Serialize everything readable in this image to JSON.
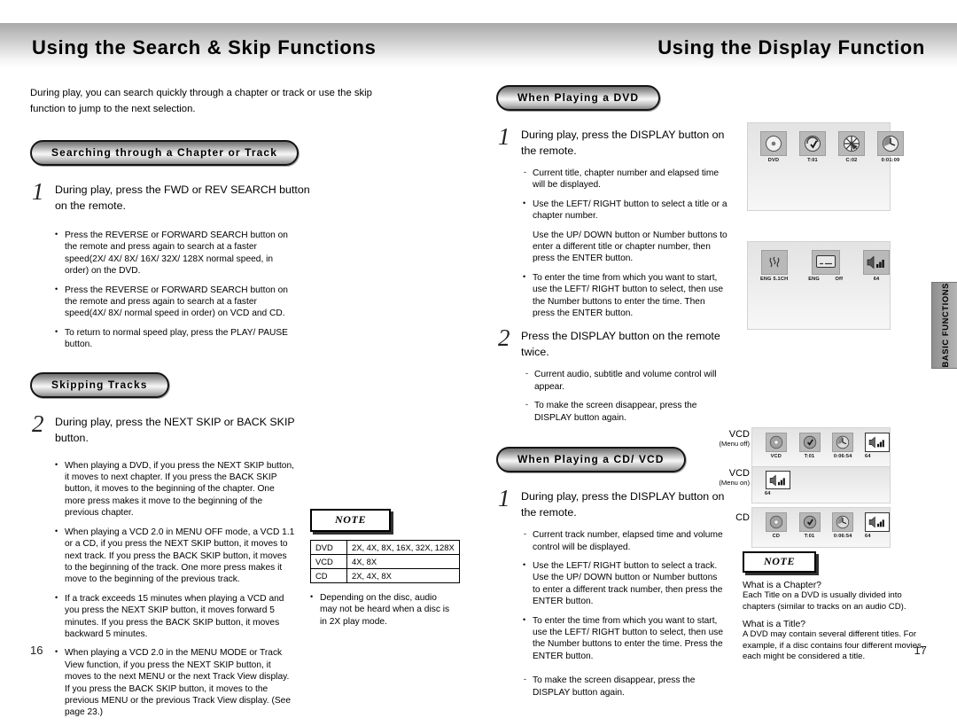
{
  "header": {
    "left_title": "Using the Search & Skip Functions",
    "right_title": "Using the Display Function"
  },
  "side_tab": {
    "line1": "BASIC",
    "line2": "FUNCTIONS"
  },
  "left_page": {
    "page_number": "16",
    "intro": "During play, you can search quickly through a chapter or track or use the skip function to jump to the next selection.",
    "section1": {
      "pill": "Searching through a Chapter or Track",
      "step_number": "1",
      "step_text": "During play, press the FWD or REV SEARCH button on the remote.",
      "bullets": [
        "Press the REVERSE or FORWARD SEARCH button on the remote and press again to search at a faster speed(2X/ 4X/ 8X/ 16X/ 32X/ 128X normal speed, in order) on the DVD.",
        "Press the REVERSE or FORWARD SEARCH button on the remote and press again to search at a faster speed(4X/ 8X/ normal speed in order) on VCD and CD.",
        "To return to normal speed play, press the PLAY/ PAUSE button."
      ]
    },
    "section2": {
      "pill": "Skipping Tracks",
      "step_number": "2",
      "step_text": "During play, press the NEXT SKIP or BACK SKIP button.",
      "bullets": [
        "When playing a DVD, if you press the NEXT SKIP button, it moves to next chapter. If you press the BACK SKIP button, it moves to the beginning of the chapter. One more press makes it move to the beginning of the previous chapter.",
        "When playing a VCD 2.0 in MENU OFF mode, a VCD 1.1 or a CD, if you press the NEXT SKIP button, it moves to next track. If you press the BACK SKIP button, it moves to the beginning of the track. One more press makes it move to the beginning of the previous track.",
        "If a track exceeds 15 minutes when playing a VCD and you press the NEXT SKIP button, it moves forward 5 minutes. If you press the BACK SKIP button, it moves backward 5 minutes.",
        "When playing a VCD 2.0 in the MENU MODE or Track View function, if you press the NEXT SKIP button, it moves to the next MENU or the next Track View display. If you press the BACK SKIP button, it moves to the previous MENU or the previous Track View display. (See page 23.)"
      ]
    },
    "note": {
      "label": "NOTE",
      "table": [
        {
          "disc": "DVD",
          "speeds": "2X, 4X, 8X, 16X, 32X, 128X"
        },
        {
          "disc": "VCD",
          "speeds": "4X, 8X"
        },
        {
          "disc": "CD",
          "speeds": "2X, 4X, 8X"
        }
      ],
      "bullet": "Depending on the disc, audio may not be heard when a disc is in 2X play mode."
    }
  },
  "right_page": {
    "page_number": "17",
    "section_dvd": {
      "pill": "When Playing a DVD",
      "step1": {
        "number": "1",
        "text": "During play, press the DISPLAY button on the remote.",
        "dash1": "Current title, chapter number and elapsed time will be displayed.",
        "bullet1": "Use the LEFT/ RIGHT button to select a title or a chapter number.",
        "plain1": "Use the UP/ DOWN button or Number buttons to enter a different title or chapter number, then press the ENTER button.",
        "bullet2": "To enter the time from which you want to start, use the LEFT/ RIGHT button to select, then use the Number buttons to enter the time. Then press the ENTER button."
      },
      "step2": {
        "number": "2",
        "text": "Press the DISPLAY button on the remote twice.",
        "dash1": "Current audio, subtitle and volume control will appear.",
        "dash2": "To make the screen disappear, press the DISPLAY button again."
      }
    },
    "section_cdvcd": {
      "pill": "When Playing a CD/ VCD",
      "step1": {
        "number": "1",
        "text": "During play, press the DISPLAY button on the remote.",
        "dash1": "Current track number, elapsed time and volume control will be displayed.",
        "bullet1": "Use the LEFT/ RIGHT button to select a track. Use the UP/ DOWN button or Number buttons to enter a different track number, then press the ENTER button.",
        "bullet2": "To enter the time from which you want to start, use the LEFT/ RIGHT button to select, then use the Number buttons to enter the time. Press the ENTER button.",
        "dash2": "To make the screen disappear, press the DISPLAY button again."
      }
    },
    "osd_dvd_1": {
      "items": [
        {
          "icon": "disc-icon",
          "label": "DVD"
        },
        {
          "icon": "title-icon",
          "label": "T:01"
        },
        {
          "icon": "chapter-icon",
          "label": "C:02"
        },
        {
          "icon": "clock-icon",
          "label": "0:01:09"
        }
      ]
    },
    "osd_dvd_2": {
      "items": [
        {
          "icon": "audio-icon",
          "label": "ENG 5.1CH"
        },
        {
          "icon": "subtitle-icon",
          "label_a": "ENG",
          "label_b": "Off"
        },
        {
          "icon": "volume-icon",
          "label": "64"
        }
      ]
    },
    "osd_vcd_menu_off": {
      "caption_main": "VCD",
      "caption_sub": "(Menu off)",
      "items": [
        {
          "icon": "disc-icon",
          "label": "VCD"
        },
        {
          "icon": "track-icon",
          "label": "T:01"
        },
        {
          "icon": "clock-icon",
          "label": "0:06:54"
        },
        {
          "icon": "volume-icon",
          "label": "64"
        }
      ]
    },
    "osd_vcd_menu_on": {
      "caption_main": "VCD",
      "caption_sub": "(Menu on)",
      "items": [
        {
          "icon": "volume-icon",
          "label": "64"
        }
      ]
    },
    "osd_cd": {
      "caption_main": "CD",
      "caption_sub": "",
      "items": [
        {
          "icon": "disc-icon",
          "label": "CD"
        },
        {
          "icon": "track-icon",
          "label": "T:01"
        },
        {
          "icon": "clock-icon",
          "label": "0:06:54"
        },
        {
          "icon": "volume-icon",
          "label": "64"
        }
      ]
    },
    "note": {
      "label": "NOTE",
      "q1": "What is a Chapter?",
      "a1": "Each Title on a DVD is usually divided into chapters (similar to tracks on an audio CD).",
      "q2": "What is a Title?",
      "a2": "A DVD may contain several different titles. For example, if a disc contains four different movies, each might be considered a title."
    }
  }
}
